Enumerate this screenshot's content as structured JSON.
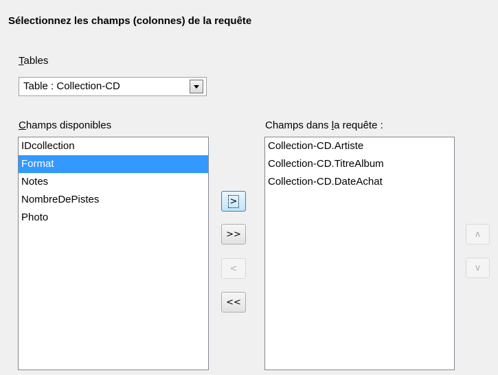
{
  "title": "Sélectionnez les champs (colonnes) de la requête",
  "tables": {
    "label_first": "T",
    "label_rest": "ables",
    "selected": "Table : Collection-CD"
  },
  "available": {
    "label_first": "C",
    "label_rest": "hamps disponibles",
    "items": [
      "IDcollection",
      "Format",
      "Notes",
      "NombreDePistes",
      "Photo"
    ],
    "selected_index": 1
  },
  "query": {
    "label_pre": "Champs dans ",
    "label_u": "l",
    "label_post": "a requête :",
    "items": [
      "Collection-CD.Artiste",
      "Collection-CD.TitreAlbum",
      "Collection-CD.DateAchat"
    ]
  },
  "buttons": {
    "add_one": ">",
    "add_all": ">>",
    "remove_one": "<",
    "remove_all": "<<",
    "move_up": "∧",
    "move_down": "∨"
  }
}
